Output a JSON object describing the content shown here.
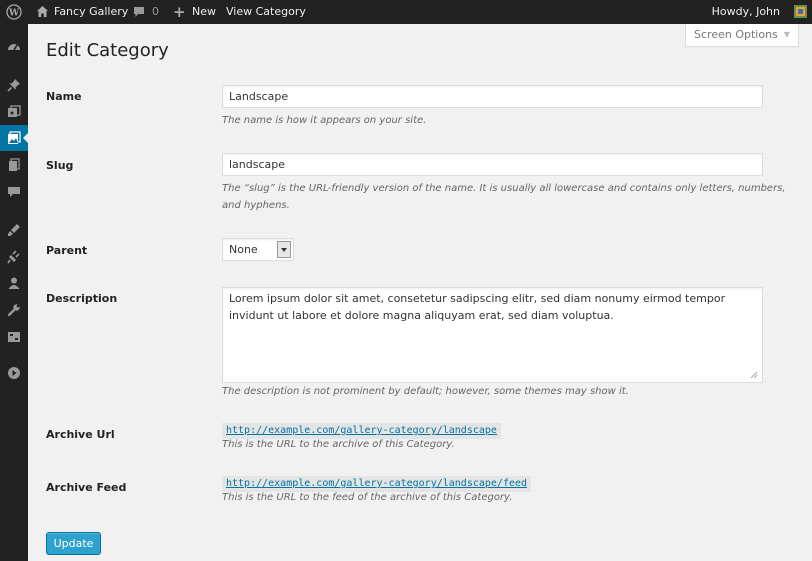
{
  "admin_bar": {
    "site_name": "Fancy Gallery",
    "comment_count": "0",
    "new_label": "New",
    "view_label": "View Category",
    "greeting": "Howdy, John"
  },
  "side_menu": {
    "icons": [
      "dashboard-icon",
      "pin-icon",
      "media-icon",
      "gallery-icon",
      "pages-icon",
      "comments-icon",
      "appearance-icon",
      "plugins-icon",
      "users-icon",
      "tools-icon",
      "settings-icon",
      "collapse-icon"
    ],
    "current": "gallery-icon"
  },
  "screen_options": {
    "label": "Screen Options"
  },
  "page": {
    "title": "Edit Category"
  },
  "form": {
    "name": {
      "label": "Name",
      "value": "Landscape",
      "help": "The name is how it appears on your site."
    },
    "slug": {
      "label": "Slug",
      "value": "landscape",
      "help": "The “slug” is the URL-friendly version of the name. It is usually all lowercase and contains only letters, numbers, and hyphens."
    },
    "parent": {
      "label": "Parent",
      "selected": "None"
    },
    "description": {
      "label": "Description",
      "value": "Lorem ipsum dolor sit amet, consetetur sadipscing elitr, sed diam nonumy eirmod tempor invidunt ut labore et dolore magna aliquyam erat, sed diam voluptua.",
      "help": "The description is not prominent by default; however, some themes may show it."
    },
    "archive_url": {
      "label": "Archive Url",
      "url": "http://example.com/gallery-category/landscape",
      "help": "This is the URL to the archive of this Category."
    },
    "archive_feed": {
      "label": "Archive Feed",
      "url": "http://example.com/gallery-category/landscape/feed",
      "help": "This is the URL to the feed of the archive of this Category."
    }
  },
  "update_button": {
    "label": "Update"
  },
  "colors": {
    "admin_bar_bg": "#222222",
    "content_bg": "#f1f1f1",
    "accent": "#0074a2",
    "button_bg": "#2ea2cc"
  }
}
